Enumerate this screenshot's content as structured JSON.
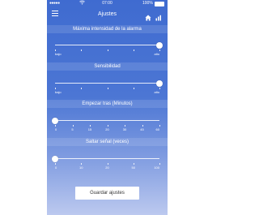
{
  "status_bar": {
    "signal": "●●●●●",
    "carrier": "",
    "time": "07:00",
    "battery": "100%"
  },
  "nav": {
    "title": "Ajustes"
  },
  "sections": [
    {
      "title": "Máxima intensidad de la alarma",
      "value_fraction": 1.0,
      "ticks": 5,
      "labels": [
        {
          "text": "bajo",
          "pos": 0
        },
        {
          "text": "alto",
          "pos": 1
        }
      ]
    },
    {
      "title": "Sensibilidad",
      "value_fraction": 1.0,
      "ticks": 5,
      "labels": [
        {
          "text": "bajo",
          "pos": 0
        },
        {
          "text": "alto",
          "pos": 1
        }
      ]
    },
    {
      "title": "Empezar tras (Minutos)",
      "value_fraction": 0.0,
      "ticks": 7,
      "labels": [
        {
          "text": "0",
          "pos": 0
        },
        {
          "text": "5",
          "pos": 0.1667
        },
        {
          "text": "15",
          "pos": 0.3333
        },
        {
          "text": "20",
          "pos": 0.5
        },
        {
          "text": "30",
          "pos": 0.6667
        },
        {
          "text": "45",
          "pos": 0.8333
        },
        {
          "text": "60",
          "pos": 1
        }
      ]
    },
    {
      "title": "Saltar señal (veces)",
      "value_fraction": 0.0,
      "ticks": 5,
      "labels": [
        {
          "text": "0",
          "pos": 0
        },
        {
          "text": "10",
          "pos": 0.25
        },
        {
          "text": "20",
          "pos": 0.5
        },
        {
          "text": "50",
          "pos": 0.75
        },
        {
          "text": "100",
          "pos": 1
        }
      ]
    }
  ],
  "save_button": {
    "label": "Guardar ajustes"
  },
  "colors": {
    "accent": "#3f6bd0",
    "text_light": "#ffffff"
  }
}
